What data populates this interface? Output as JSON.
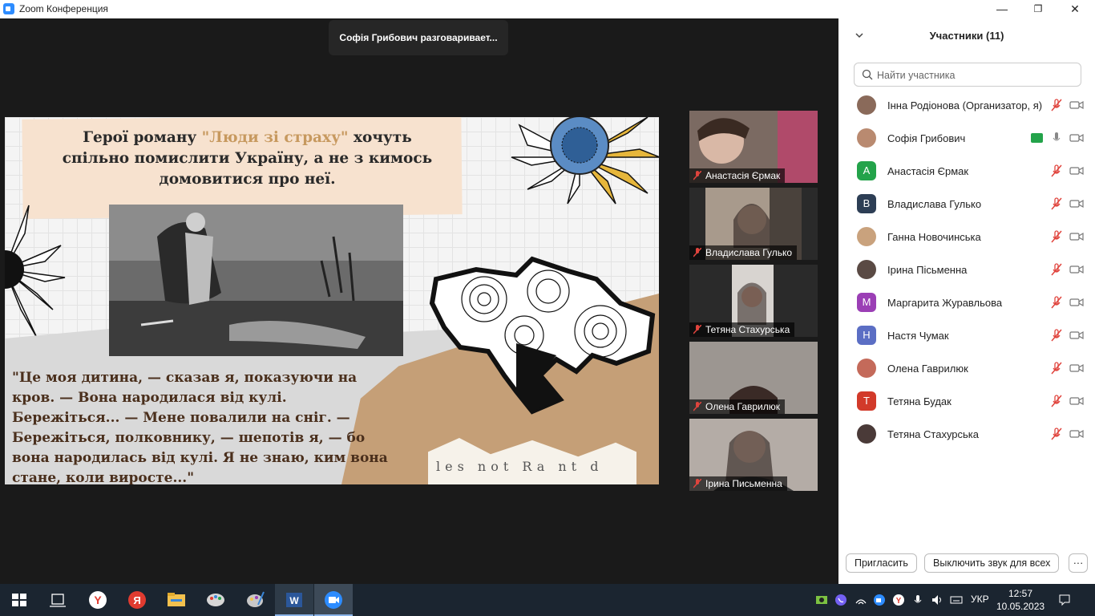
{
  "window": {
    "title": "Zoom Конференция",
    "minimize": "—",
    "maximize": "❐",
    "close": "✕"
  },
  "meeting": {
    "talking_indicator": "Софія Грибович разговаривает...",
    "slide": {
      "headline_before": "Герої роману ",
      "headline_highlight": "\"Люди зі страху\"",
      "headline_after": " хочуть спільно помислити Україну, а не з кимось домовитися про неї.",
      "quote": "\"Це моя дитина, — сказав я, показуючи на кров. — Вона народилася від кулі. Бережіться... — Мене повалили на сніг. — Бережіться, полковнику, — шепотів я, — бо вона народилась від кулі. Я не знаю, ким вона стане, коли виросте...\"",
      "newsprint_text": "les not Ra nt d"
    },
    "thumbnails": [
      {
        "name": "Анастасія Єрмак"
      },
      {
        "name": "Владислава Гулько"
      },
      {
        "name": "Тетяна Стахурська"
      },
      {
        "name": "Олена Гаврилюк"
      },
      {
        "name": "Ірина Письменна"
      }
    ]
  },
  "participants": {
    "header": "Участники (11)",
    "search_placeholder": "Найти участника",
    "list": [
      {
        "name": "Інна Родіонова (Организатор, я)",
        "avatar": "",
        "color": "#8a6a5a",
        "photo": true
      },
      {
        "name": "Софія Грибович",
        "avatar": "",
        "color": "#b98a70",
        "photo": true,
        "speaking": true
      },
      {
        "name": "Анастасія Єрмак",
        "avatar": "A",
        "color": "#23a34a"
      },
      {
        "name": "Владислава Гулько",
        "avatar": "B",
        "color": "#2d3e55"
      },
      {
        "name": "Ганна Новочинська",
        "avatar": "",
        "color": "#c9a27d",
        "photo": true
      },
      {
        "name": "Ірина Пісьменна",
        "avatar": "",
        "color": "#5a4a44",
        "photo": true
      },
      {
        "name": "Маргарита Журавльова",
        "avatar": "M",
        "color": "#9b3fb5"
      },
      {
        "name": "Настя Чумак",
        "avatar": "H",
        "color": "#5b6ec4"
      },
      {
        "name": "Олена Гаврилюк",
        "avatar": "",
        "color": "#c46a5a",
        "photo": true
      },
      {
        "name": "Тетяна Будак",
        "avatar": "T",
        "color": "#d23a2a"
      },
      {
        "name": "Тетяна Стахурська",
        "avatar": "",
        "color": "#4a3a38",
        "photo": true
      }
    ],
    "invite_button": "Пригласить",
    "mute_all_button": "Выключить звук для всех",
    "more_button": "···"
  },
  "taskbar": {
    "language": "УКР",
    "time": "12:57",
    "date": "10.05.2023"
  }
}
